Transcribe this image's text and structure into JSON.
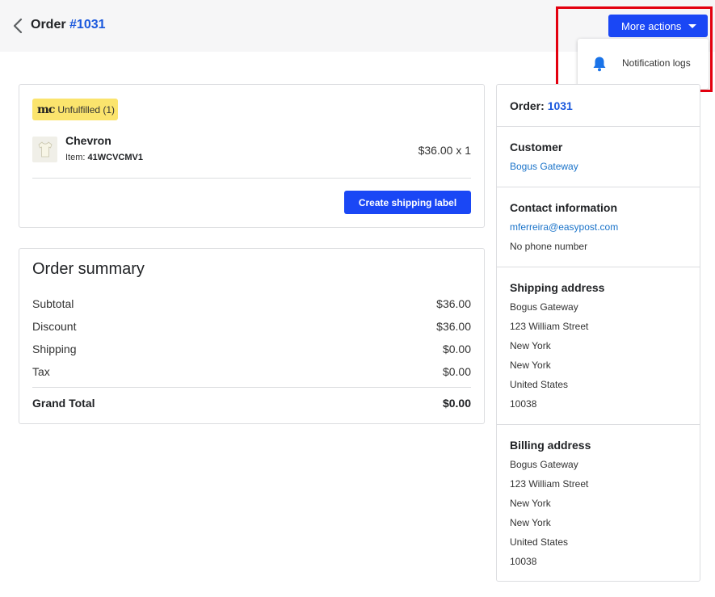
{
  "header": {
    "title_prefix": "Order",
    "order_number": "#1031",
    "more_actions_label": "More actions"
  },
  "dropdown": {
    "items": [
      {
        "label": "Notification logs",
        "icon": "bell-icon"
      }
    ]
  },
  "fulfillment": {
    "badge_logo": "mc",
    "badge_label": "Unfulfilled (1)",
    "product": {
      "name": "Chevron",
      "sku_label": "Item:",
      "sku": "41WCVCMV1",
      "price_qty": "$36.00 x 1"
    },
    "ship_button_label": "Create shipping label"
  },
  "summary": {
    "title": "Order summary",
    "rows": [
      {
        "label": "Subtotal",
        "value": "$36.00"
      },
      {
        "label": "Discount",
        "value": "$36.00"
      },
      {
        "label": "Shipping",
        "value": "$0.00"
      },
      {
        "label": "Tax",
        "value": "$0.00"
      }
    ],
    "total_label": "Grand Total",
    "total_value": "$0.00"
  },
  "sidebar": {
    "order_label": "Order:",
    "order_id": "1031",
    "customer_heading": "Customer",
    "customer_name": "Bogus Gateway",
    "contact_heading": "Contact information",
    "contact_email": "mferreira@easypost.com",
    "contact_phone": "No phone number",
    "shipping_heading": "Shipping address",
    "shipping_lines": [
      "Bogus Gateway",
      "123 William Street",
      "New York",
      "New York",
      "United States",
      "10038"
    ],
    "billing_heading": "Billing address",
    "billing_lines": [
      "Bogus Gateway",
      "123 William Street",
      "New York",
      "New York",
      "United States",
      "10038"
    ]
  },
  "colors": {
    "primary": "#1a47f5",
    "link": "#1a58dd",
    "badge": "#fbe46d",
    "highlight": "#e3000f"
  }
}
